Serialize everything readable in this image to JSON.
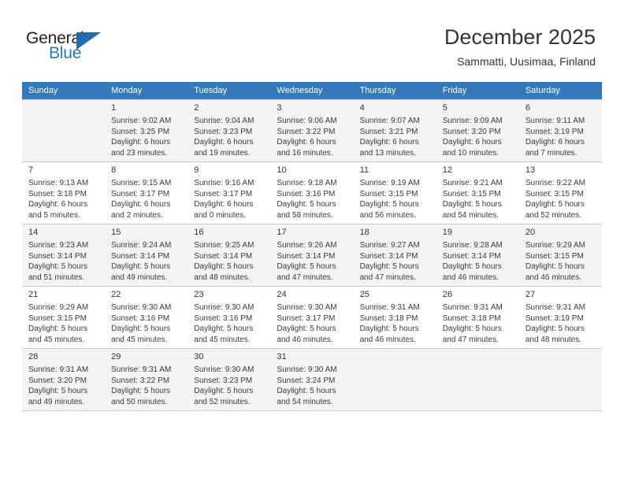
{
  "brand": {
    "word_one": "General",
    "word_two": "Blue",
    "triangle_icon": "blue-triangle-icon",
    "accent_color": "#1f7ac0"
  },
  "header": {
    "title": "December 2025",
    "subtitle": "Sammatti, Uusimaa, Finland"
  },
  "theme": {
    "header_row_bg": "#3479bb",
    "alt_row_bg": "#f4f4f4",
    "grid_line": "#c8c8c8",
    "text": "#333333"
  },
  "calendar": {
    "weekday_headers": [
      "Sunday",
      "Monday",
      "Tuesday",
      "Wednesday",
      "Thursday",
      "Friday",
      "Saturday"
    ],
    "weeks": [
      [
        {
          "day": "",
          "lines": []
        },
        {
          "day": "1",
          "lines": [
            "Sunrise: 9:02 AM",
            "Sunset: 3:25 PM",
            "Daylight: 6 hours",
            "and 23 minutes."
          ]
        },
        {
          "day": "2",
          "lines": [
            "Sunrise: 9:04 AM",
            "Sunset: 3:23 PM",
            "Daylight: 6 hours",
            "and 19 minutes."
          ]
        },
        {
          "day": "3",
          "lines": [
            "Sunrise: 9:06 AM",
            "Sunset: 3:22 PM",
            "Daylight: 6 hours",
            "and 16 minutes."
          ]
        },
        {
          "day": "4",
          "lines": [
            "Sunrise: 9:07 AM",
            "Sunset: 3:21 PM",
            "Daylight: 6 hours",
            "and 13 minutes."
          ]
        },
        {
          "day": "5",
          "lines": [
            "Sunrise: 9:09 AM",
            "Sunset: 3:20 PM",
            "Daylight: 6 hours",
            "and 10 minutes."
          ]
        },
        {
          "day": "6",
          "lines": [
            "Sunrise: 9:11 AM",
            "Sunset: 3:19 PM",
            "Daylight: 6 hours",
            "and 7 minutes."
          ]
        }
      ],
      [
        {
          "day": "7",
          "lines": [
            "Sunrise: 9:13 AM",
            "Sunset: 3:18 PM",
            "Daylight: 6 hours",
            "and 5 minutes."
          ]
        },
        {
          "day": "8",
          "lines": [
            "Sunrise: 9:15 AM",
            "Sunset: 3:17 PM",
            "Daylight: 6 hours",
            "and 2 minutes."
          ]
        },
        {
          "day": "9",
          "lines": [
            "Sunrise: 9:16 AM",
            "Sunset: 3:17 PM",
            "Daylight: 6 hours",
            "and 0 minutes."
          ]
        },
        {
          "day": "10",
          "lines": [
            "Sunrise: 9:18 AM",
            "Sunset: 3:16 PM",
            "Daylight: 5 hours",
            "and 58 minutes."
          ]
        },
        {
          "day": "11",
          "lines": [
            "Sunrise: 9:19 AM",
            "Sunset: 3:15 PM",
            "Daylight: 5 hours",
            "and 56 minutes."
          ]
        },
        {
          "day": "12",
          "lines": [
            "Sunrise: 9:21 AM",
            "Sunset: 3:15 PM",
            "Daylight: 5 hours",
            "and 54 minutes."
          ]
        },
        {
          "day": "13",
          "lines": [
            "Sunrise: 9:22 AM",
            "Sunset: 3:15 PM",
            "Daylight: 5 hours",
            "and 52 minutes."
          ]
        }
      ],
      [
        {
          "day": "14",
          "lines": [
            "Sunrise: 9:23 AM",
            "Sunset: 3:14 PM",
            "Daylight: 5 hours",
            "and 51 minutes."
          ]
        },
        {
          "day": "15",
          "lines": [
            "Sunrise: 9:24 AM",
            "Sunset: 3:14 PM",
            "Daylight: 5 hours",
            "and 49 minutes."
          ]
        },
        {
          "day": "16",
          "lines": [
            "Sunrise: 9:25 AM",
            "Sunset: 3:14 PM",
            "Daylight: 5 hours",
            "and 48 minutes."
          ]
        },
        {
          "day": "17",
          "lines": [
            "Sunrise: 9:26 AM",
            "Sunset: 3:14 PM",
            "Daylight: 5 hours",
            "and 47 minutes."
          ]
        },
        {
          "day": "18",
          "lines": [
            "Sunrise: 9:27 AM",
            "Sunset: 3:14 PM",
            "Daylight: 5 hours",
            "and 47 minutes."
          ]
        },
        {
          "day": "19",
          "lines": [
            "Sunrise: 9:28 AM",
            "Sunset: 3:14 PM",
            "Daylight: 5 hours",
            "and 46 minutes."
          ]
        },
        {
          "day": "20",
          "lines": [
            "Sunrise: 9:29 AM",
            "Sunset: 3:15 PM",
            "Daylight: 5 hours",
            "and 46 minutes."
          ]
        }
      ],
      [
        {
          "day": "21",
          "lines": [
            "Sunrise: 9:29 AM",
            "Sunset: 3:15 PM",
            "Daylight: 5 hours",
            "and 45 minutes."
          ]
        },
        {
          "day": "22",
          "lines": [
            "Sunrise: 9:30 AM",
            "Sunset: 3:16 PM",
            "Daylight: 5 hours",
            "and 45 minutes."
          ]
        },
        {
          "day": "23",
          "lines": [
            "Sunrise: 9:30 AM",
            "Sunset: 3:16 PM",
            "Daylight: 5 hours",
            "and 45 minutes."
          ]
        },
        {
          "day": "24",
          "lines": [
            "Sunrise: 9:30 AM",
            "Sunset: 3:17 PM",
            "Daylight: 5 hours",
            "and 46 minutes."
          ]
        },
        {
          "day": "25",
          "lines": [
            "Sunrise: 9:31 AM",
            "Sunset: 3:18 PM",
            "Daylight: 5 hours",
            "and 46 minutes."
          ]
        },
        {
          "day": "26",
          "lines": [
            "Sunrise: 9:31 AM",
            "Sunset: 3:18 PM",
            "Daylight: 5 hours",
            "and 47 minutes."
          ]
        },
        {
          "day": "27",
          "lines": [
            "Sunrise: 9:31 AM",
            "Sunset: 3:19 PM",
            "Daylight: 5 hours",
            "and 48 minutes."
          ]
        }
      ],
      [
        {
          "day": "28",
          "lines": [
            "Sunrise: 9:31 AM",
            "Sunset: 3:20 PM",
            "Daylight: 5 hours",
            "and 49 minutes."
          ]
        },
        {
          "day": "29",
          "lines": [
            "Sunrise: 9:31 AM",
            "Sunset: 3:22 PM",
            "Daylight: 5 hours",
            "and 50 minutes."
          ]
        },
        {
          "day": "30",
          "lines": [
            "Sunrise: 9:30 AM",
            "Sunset: 3:23 PM",
            "Daylight: 5 hours",
            "and 52 minutes."
          ]
        },
        {
          "day": "31",
          "lines": [
            "Sunrise: 9:30 AM",
            "Sunset: 3:24 PM",
            "Daylight: 5 hours",
            "and 54 minutes."
          ]
        },
        {
          "day": "",
          "lines": []
        },
        {
          "day": "",
          "lines": []
        },
        {
          "day": "",
          "lines": []
        }
      ]
    ]
  }
}
